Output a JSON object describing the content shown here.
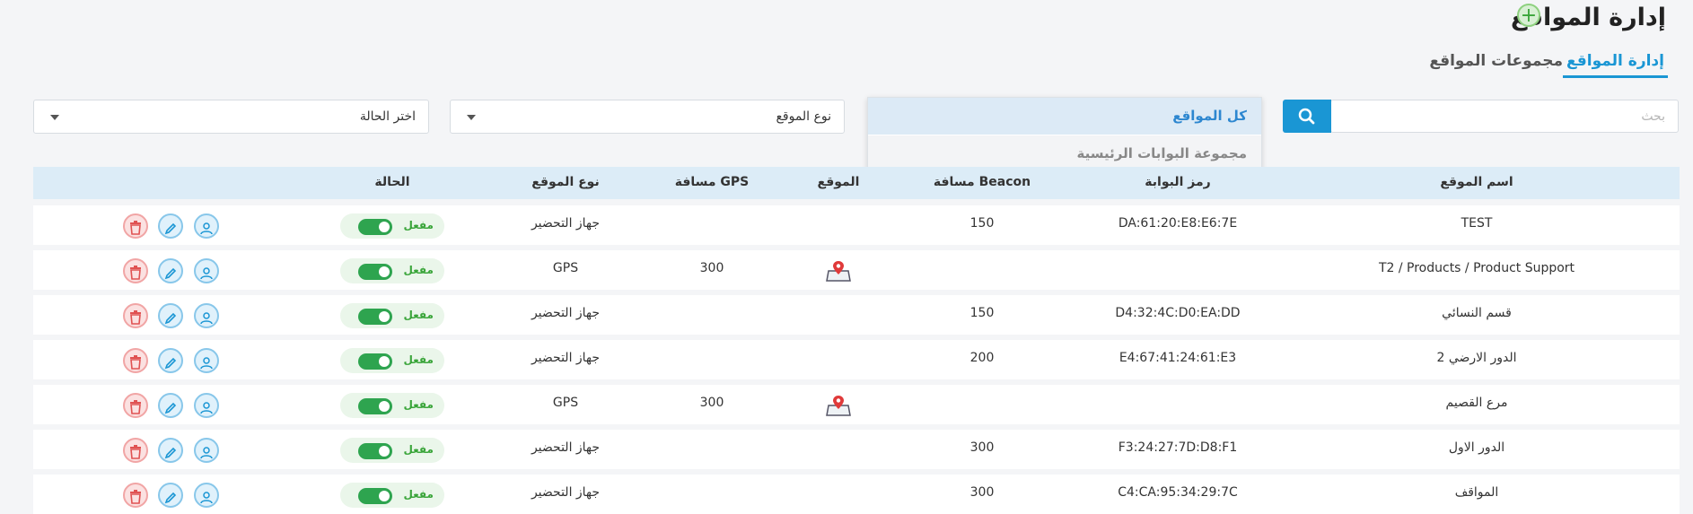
{
  "header": {
    "title": "إدارة المواقع",
    "add_icon": "plus-icon"
  },
  "tabs": [
    {
      "label": "إدارة المواقع",
      "active": true
    },
    {
      "label": "مجموعات المواقع",
      "active": false
    }
  ],
  "search": {
    "placeholder": "بحث",
    "button_icon": "search-icon"
  },
  "group_dropdown": {
    "options": [
      "كل المواقع",
      "مجموعة البوابات الرئيسية"
    ],
    "selected": "كل المواقع"
  },
  "filters": {
    "site_type": "نوع الموقع",
    "status": "اختر الحالة"
  },
  "table": {
    "headers": {
      "name": "اسم الموقع",
      "gate_code": "رمز البوابة",
      "beacon_distance": "مسافة Beacon",
      "location": "الموقع",
      "gps_distance": "مسافة GPS",
      "site_type": "نوع الموقع",
      "status": "الحالة"
    },
    "rows": [
      {
        "name": "TEST",
        "gate_code": "DA:61:20:E8:E6:7E",
        "beacon_distance": "150",
        "has_map": false,
        "gps_distance": "",
        "site_type": "جهاز التحضير",
        "status": "مفعل"
      },
      {
        "name": "T2 / Products / Product Support",
        "gate_code": "",
        "beacon_distance": "",
        "has_map": true,
        "gps_distance": "300",
        "site_type": "GPS",
        "status": "مفعل"
      },
      {
        "name": "قسم النسائي",
        "gate_code": "D4:32:4C:D0:EA:DD",
        "beacon_distance": "150",
        "has_map": false,
        "gps_distance": "",
        "site_type": "جهاز التحضير",
        "status": "مفعل"
      },
      {
        "name": "الدور الارضي 2",
        "gate_code": "E4:67:41:24:61:E3",
        "beacon_distance": "200",
        "has_map": false,
        "gps_distance": "",
        "site_type": "جهاز التحضير",
        "status": "مفعل"
      },
      {
        "name": "مرع القصيم",
        "gate_code": "",
        "beacon_distance": "",
        "has_map": true,
        "gps_distance": "300",
        "site_type": "GPS",
        "status": "مفعل"
      },
      {
        "name": "الدور الاول",
        "gate_code": "F3:24:27:7D:D8:F1",
        "beacon_distance": "300",
        "has_map": false,
        "gps_distance": "",
        "site_type": "جهاز التحضير",
        "status": "مفعل"
      },
      {
        "name": "المواقف",
        "gate_code": "C4:CA:95:34:29:7C",
        "beacon_distance": "300",
        "has_map": false,
        "gps_distance": "",
        "site_type": "جهاز التحضير",
        "status": "مفعل"
      }
    ]
  },
  "colors": {
    "accent": "#1a96d4",
    "enabled": "#2ea44f",
    "delete": "#e05252"
  }
}
